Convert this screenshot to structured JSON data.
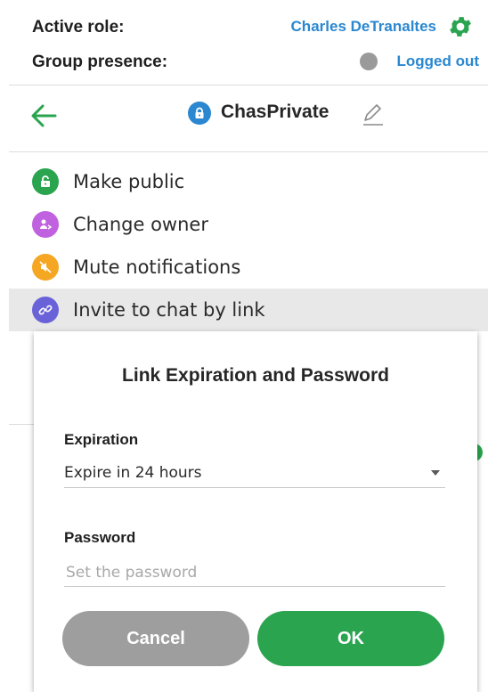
{
  "status": {
    "active_role_label": "Active role:",
    "active_role_value": "Charles DeTranaltes",
    "group_presence_label": "Group presence:",
    "group_presence_value": "Logged out"
  },
  "chat": {
    "title": "ChasPrivate"
  },
  "menu": {
    "items": [
      {
        "label": "Make public",
        "icon": "lock-open-icon",
        "color": "#2aa44f"
      },
      {
        "label": "Change owner",
        "icon": "user-swap-icon",
        "color": "#c062e0"
      },
      {
        "label": "Mute notifications",
        "icon": "mute-icon",
        "color": "#f5a623"
      },
      {
        "label": "Invite to chat by link",
        "icon": "link-icon",
        "color": "#6a62d8"
      }
    ]
  },
  "dialog": {
    "title": "Link Expiration and Password",
    "expiration_label": "Expiration",
    "expiration_value": "Expire in 24 hours",
    "password_label": "Password",
    "password_placeholder": "Set the password",
    "cancel_label": "Cancel",
    "ok_label": "OK"
  },
  "colors": {
    "accent_blue": "#2a87d0",
    "green": "#2aa44f",
    "grey_button": "#9e9e9e",
    "active_bg": "#e8e8e8"
  }
}
